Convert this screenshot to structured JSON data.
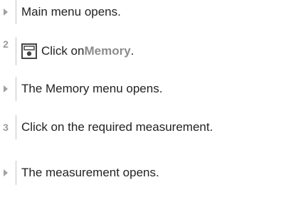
{
  "steps": [
    {
      "type": "result",
      "text": "Main menu opens."
    },
    {
      "type": "step",
      "number": "2",
      "icon": "memory-icon",
      "prefix": "Click on ",
      "highlight": "Memory",
      "suffix": "."
    },
    {
      "type": "result",
      "text": "The Memory menu opens."
    },
    {
      "type": "step",
      "number": "3",
      "text": "Click on the required measurement."
    },
    {
      "type": "result",
      "text": "The measurement opens."
    }
  ]
}
